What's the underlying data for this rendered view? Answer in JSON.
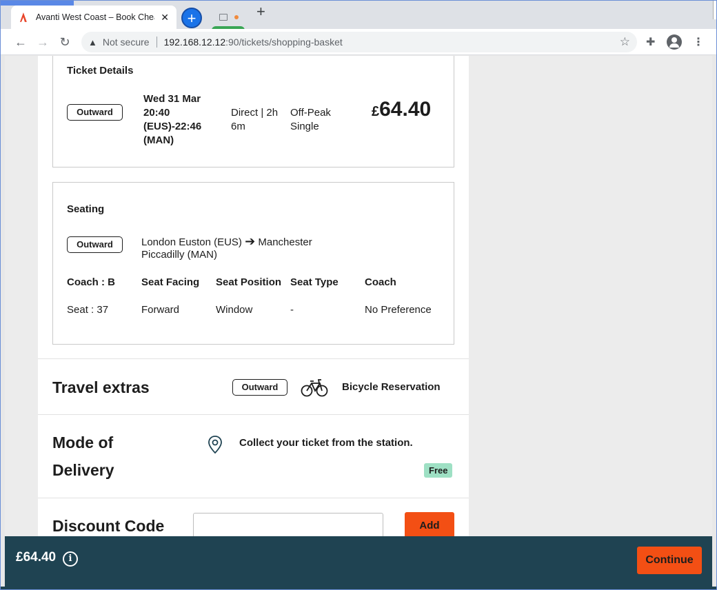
{
  "browser": {
    "tab_title": "Avanti West Coast – Book Cheap",
    "security_label": "Not secure",
    "url_host": "192.168.12.12",
    "url_rest": ":90/tickets/shopping-basket"
  },
  "ticket_details": {
    "heading": "Ticket Details",
    "direction": "Outward",
    "journey_line1": "Wed 31 Mar",
    "journey_line2": "20:40",
    "journey_line3": "(EUS)-22:46",
    "journey_line4": "(MAN)",
    "route_type_line1": "Direct | 2h",
    "route_type_line2": "6m",
    "fare_line1": "Off-Peak",
    "fare_line2": "Single",
    "price_symbol": "£",
    "price_value": "64.40"
  },
  "seating": {
    "heading": "Seating",
    "direction": "Outward",
    "from": "London Euston (EUS)",
    "arrow": "➔",
    "to_line1": "Manchester",
    "to_line2": "Piccadilly (MAN)",
    "columns": [
      "Coach : B",
      "Seat Facing",
      "Seat Position",
      "Seat Type",
      "Coach"
    ],
    "values": [
      "Seat : 37",
      "Forward",
      "Window",
      "-",
      "No Preference"
    ]
  },
  "travel_extras": {
    "title": "Travel extras",
    "direction": "Outward",
    "item": "Bicycle Reservation"
  },
  "delivery": {
    "title_line1": "Mode of",
    "title_line2": "Delivery",
    "description": "Collect your ticket from the station.",
    "badge": "Free"
  },
  "discount": {
    "title": "Discount Code",
    "input_value": "",
    "button": "Add"
  },
  "footer": {
    "total": "£64.40",
    "info": "i",
    "continue": "Continue"
  },
  "colors": {
    "accent": "#f34f14",
    "footer_bg": "#1f4352",
    "free_badge": "#9ee0c4"
  }
}
